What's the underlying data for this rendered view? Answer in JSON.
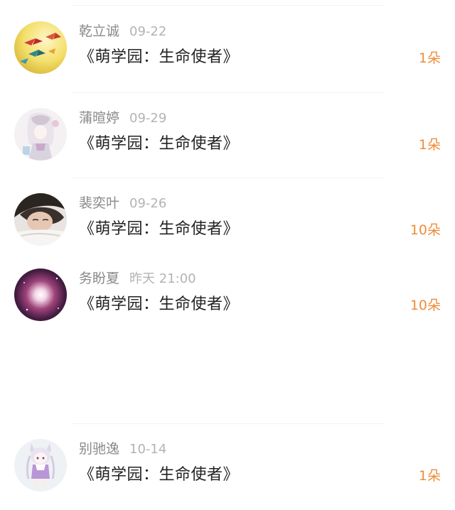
{
  "gift_list": [
    {
      "username": "乾立诚",
      "timestamp": "09-22",
      "gift_title": "《萌学园：生命使者》",
      "gift_count": "1朵",
      "avatar_icon": "paper-cranes-avatar-icon"
    },
    {
      "username": "蒲暄婷",
      "timestamp": "09-29",
      "gift_title": "《萌学园：生命使者》",
      "gift_count": "1朵",
      "avatar_icon": "anime-girl-avatar-icon"
    },
    {
      "username": "裴奕叶",
      "timestamp": "09-26",
      "gift_title": "《萌学园：生命使者》",
      "gift_count": "10朵",
      "avatar_icon": "portrait-photo-avatar-icon"
    },
    {
      "username": "务盼夏",
      "timestamp": "昨天 21:00",
      "gift_title": "《萌学园：生命使者》",
      "gift_count": "10朵",
      "avatar_icon": "galaxy-avatar-icon"
    },
    {
      "username": "别驰逸",
      "timestamp": "10-14",
      "gift_title": "《萌学园：生命使者》",
      "gift_count": "1朵",
      "avatar_icon": "chibi-character-avatar-icon"
    }
  ],
  "colors": {
    "username": "#8a8a8a",
    "timestamp": "#b3b3b3",
    "title": "#222222",
    "count_accent": "#ef8c3b",
    "divider": "#f2f2f2"
  }
}
